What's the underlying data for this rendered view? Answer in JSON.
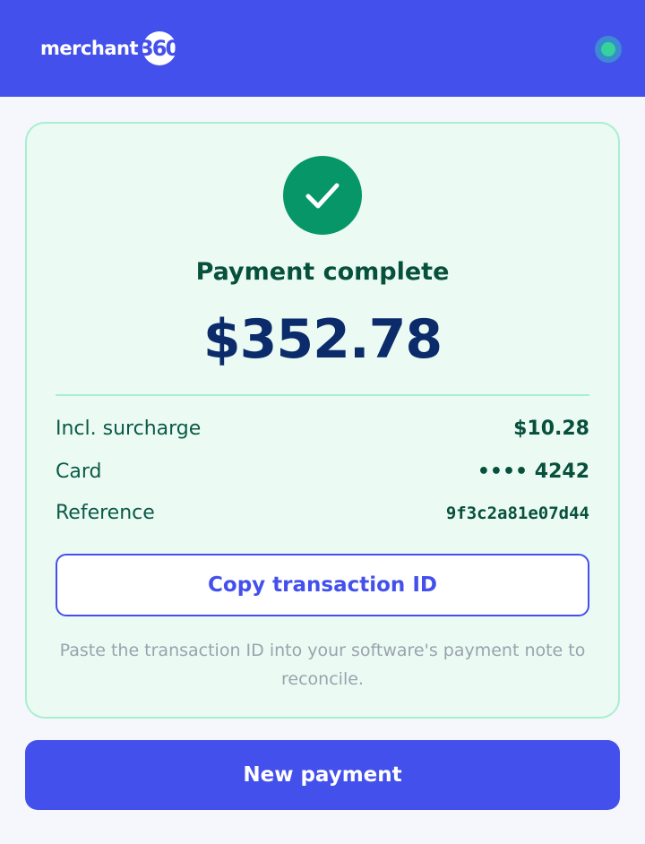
{
  "header": {
    "logo_word": "merchant",
    "logo_number": "360",
    "status_indicator": "online-dot-icon"
  },
  "receipt": {
    "status_icon": "checkmark-icon",
    "title": "Payment complete",
    "amount": "$352.78",
    "details": [
      {
        "label": "Incl. surcharge",
        "value": "$10.28"
      },
      {
        "label": "Card",
        "value": "•••• 4242"
      },
      {
        "label": "Reference",
        "value": "9f3c2a81e07d44"
      }
    ],
    "copy_label": "Copy transaction ID",
    "hint": "Paste the transaction ID into your software's payment note to reconcile."
  },
  "footer": {
    "new_payment_label": "New payment"
  },
  "colors": {
    "brand": "#4350ec",
    "success": "#069668",
    "success_bg": "#ebfbf3",
    "success_border": "#a7efcf",
    "amount_text": "#0b2b6b",
    "hint_text": "#9ba2ad"
  }
}
